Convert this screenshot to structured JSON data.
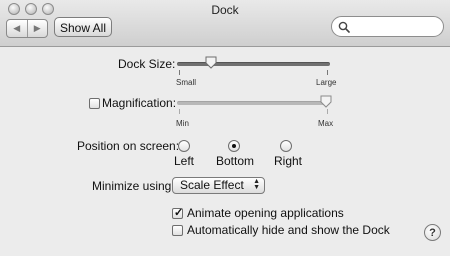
{
  "window": {
    "title": "Dock"
  },
  "toolbar": {
    "back_icon": "back-arrow-icon",
    "forward_icon": "forward-arrow-icon",
    "show_all_label": "Show All",
    "search_value": "",
    "search_icon": "search-icon"
  },
  "dock_size": {
    "label": "Dock Size:",
    "min_label": "Small",
    "max_label": "Large",
    "level": 0.22
  },
  "magnification": {
    "label": "Magnification:",
    "checked": false,
    "min_label": "Min",
    "max_label": "Max",
    "level": 1.0
  },
  "position": {
    "label": "Position on screen:",
    "options": [
      "Left",
      "Bottom",
      "Right"
    ],
    "selected": "Bottom"
  },
  "minimize": {
    "label": "Minimize using:",
    "value": "Scale Effect"
  },
  "options": {
    "animate_label": "Animate opening applications",
    "animate_checked": true,
    "autohide_label": "Automatically hide and show the Dock",
    "autohide_checked": false
  },
  "help": {
    "label": "?"
  }
}
